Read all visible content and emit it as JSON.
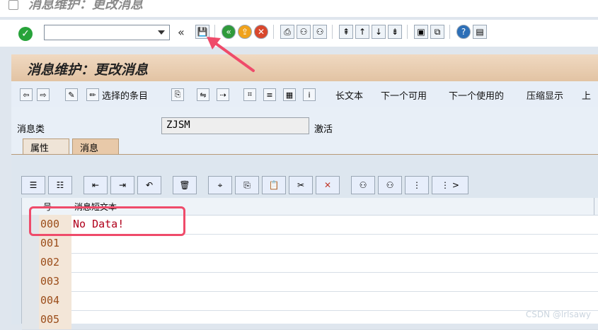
{
  "window": {
    "title": "消息维护：更改消息"
  },
  "main": {
    "header": "消息维护：更改消息",
    "toolbar": {
      "select_entry": "选择的条目",
      "long_text": "长文本",
      "next_available": "下一个可用",
      "next_used": "下一个使用的",
      "compress_display": "压缩显示",
      "up": "上"
    },
    "field": {
      "label": "消息类",
      "value": "ZJSM",
      "status": "激活"
    },
    "tabs": [
      {
        "label": "属性"
      },
      {
        "label": "消息"
      }
    ],
    "grid": {
      "columns": [
        {
          "label": "号"
        },
        {
          "label": "消息短文本"
        }
      ],
      "rows": [
        {
          "num": "000",
          "text": "No Data!"
        },
        {
          "num": "001",
          "text": ""
        },
        {
          "num": "002",
          "text": ""
        },
        {
          "num": "003",
          "text": ""
        },
        {
          "num": "004",
          "text": ""
        },
        {
          "num": "005",
          "text": ""
        }
      ],
      "toolbar_more": ">"
    }
  },
  "watermark": "CSDN @lrlsawy",
  "colors": {
    "accent_red": "#ef4b6a",
    "text_red": "#b0001b",
    "number_brown": "#9b4d1a",
    "header_band": "#e2c3a3"
  },
  "icons": {
    "ok": "check-icon",
    "save": "save-icon",
    "back": "back-icon",
    "exit": "exit-icon",
    "cancel": "cancel-icon",
    "print": "printer-icon",
    "find": "binoculars-icon",
    "find_next": "binoculars-plus-icon",
    "help": "help-icon",
    "layout": "monitor-icon"
  }
}
